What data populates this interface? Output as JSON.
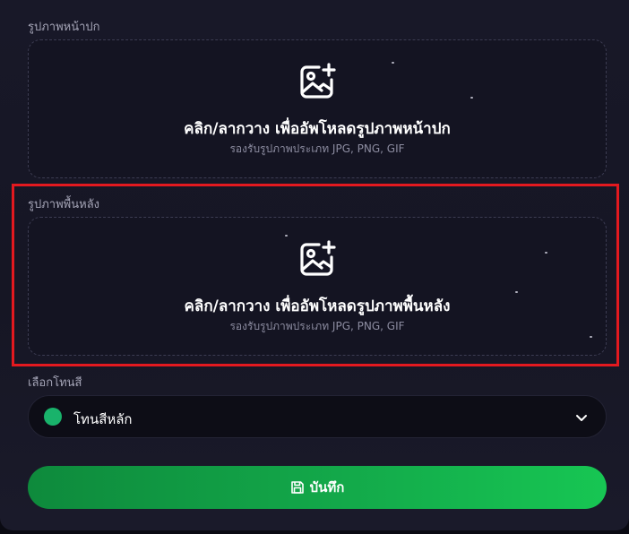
{
  "cover_image": {
    "label": "รูปภาพหน้าปก",
    "dropzone_title": "คลิก/ลากวาง เพื่ออัพโหลดรูปภาพหน้าปก",
    "dropzone_hint": "รองรับรูปภาพประเภท JPG, PNG, GIF",
    "icon": "image-add-icon"
  },
  "background_image": {
    "label": "รูปภาพพื้นหลัง",
    "dropzone_title": "คลิก/ลากวาง เพื่ออัพโหลดรูปภาพพื้นหลัง",
    "dropzone_hint": "รองรับรูปภาพประเภท JPG, PNG, GIF",
    "icon": "image-add-icon"
  },
  "theme": {
    "label": "เลือกโทนสี",
    "selected_value": "โทนสีหลัก",
    "selected_color": "#19b36b",
    "icon": "chevron-down-icon"
  },
  "save_button": {
    "label": "บันทึก",
    "icon": "floppy-disk-icon"
  },
  "colors": {
    "accent_green": "#17c653",
    "highlight_red": "#e3191f"
  }
}
